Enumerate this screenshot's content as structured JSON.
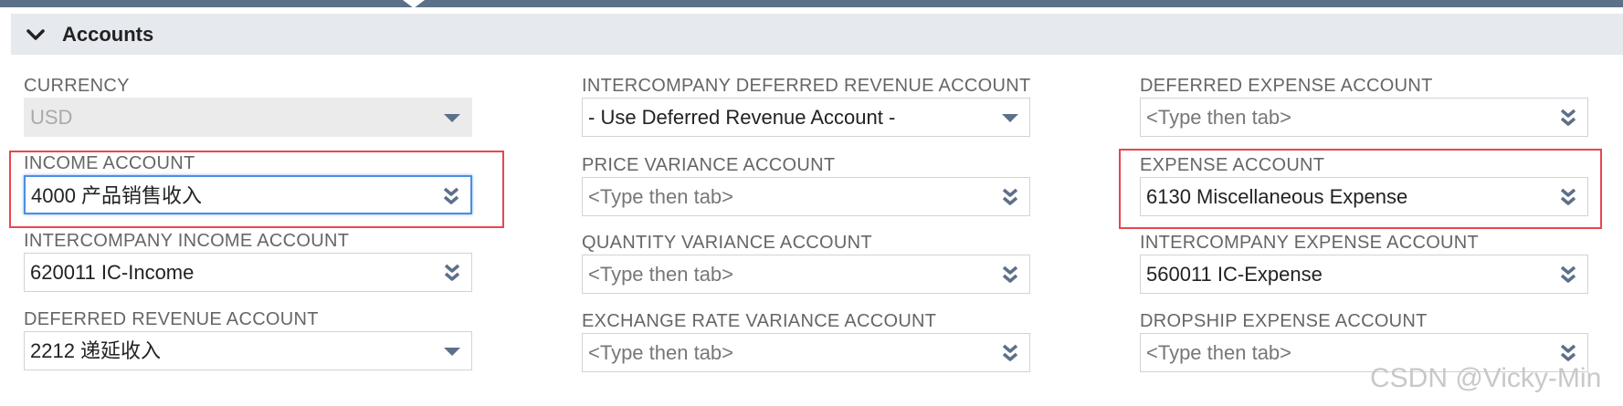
{
  "section": {
    "title": "Accounts",
    "expanded": true,
    "icon": "chevron-down-icon"
  },
  "fields": {
    "currency": {
      "label": "CURRENCY",
      "value": "USD",
      "control": "select",
      "disabled": true
    },
    "income_account": {
      "label": "INCOME ACCOUNT",
      "value": "4000 产品销售收入",
      "control": "popup-select",
      "focused": true,
      "highlighted": true
    },
    "intercompany_income_account": {
      "label": "INTERCOMPANY INCOME ACCOUNT",
      "value": "620011 IC-Income",
      "control": "popup-select"
    },
    "deferred_revenue_account": {
      "label": "DEFERRED REVENUE ACCOUNT",
      "value": "2212 递延收入",
      "control": "select"
    },
    "intercompany_deferred_revenue_account": {
      "label": "INTERCOMPANY DEFERRED REVENUE ACCOUNT",
      "value": "- Use Deferred Revenue Account -",
      "control": "select"
    },
    "price_variance_account": {
      "label": "PRICE VARIANCE ACCOUNT",
      "placeholder": "<Type then tab>",
      "control": "popup-select"
    },
    "quantity_variance_account": {
      "label": "QUANTITY VARIANCE ACCOUNT",
      "placeholder": "<Type then tab>",
      "control": "popup-select"
    },
    "exchange_rate_variance_account": {
      "label": "EXCHANGE RATE VARIANCE ACCOUNT",
      "placeholder": "<Type then tab>",
      "control": "popup-select"
    },
    "deferred_expense_account": {
      "label": "DEFERRED EXPENSE ACCOUNT",
      "placeholder": "<Type then tab>",
      "control": "popup-select"
    },
    "expense_account": {
      "label": "EXPENSE ACCOUNT",
      "value": "6130 Miscellaneous Expense",
      "control": "popup-select",
      "highlighted": true
    },
    "intercompany_expense_account": {
      "label": "INTERCOMPANY EXPENSE ACCOUNT",
      "value": "560011 IC-Expense",
      "control": "popup-select"
    },
    "dropship_expense_account": {
      "label": "DROPSHIP EXPENSE ACCOUNT",
      "placeholder": "<Type then tab>",
      "control": "popup-select"
    }
  },
  "icons": {
    "select": "dropdown-arrow-icon",
    "popup_select": "double-chevron-down-icon"
  },
  "colors": {
    "accent_bar": "#5d7089",
    "section_header_bg": "#e6e9ee",
    "highlight_border": "#e8464e",
    "focus_border": "#4a90e2",
    "icon": "#5d7089"
  },
  "watermark": "CSDN @Vicky-Min"
}
